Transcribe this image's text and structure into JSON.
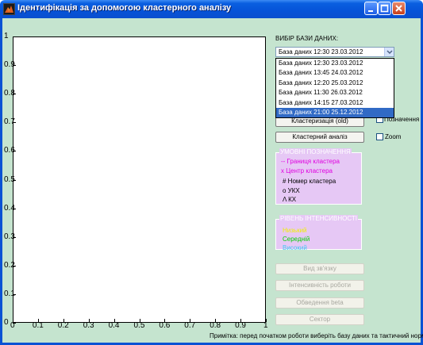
{
  "window": {
    "title": "Ідентифікація за допомогою кластерного аналізу"
  },
  "axes": {
    "y_ticks": [
      "1",
      "0.9",
      "0.8",
      "0.7",
      "0.6",
      "0.5",
      "0.4",
      "0.3",
      "0.2",
      "0.1",
      "0"
    ],
    "x_ticks": [
      "0",
      "0.1",
      "0.2",
      "0.3",
      "0.4",
      "0.5",
      "0.6",
      "0.7",
      "0.8",
      "0.9",
      "1"
    ]
  },
  "database": {
    "label": "ВИБІР БАЗИ ДАНИХ:",
    "selected": "База даних 12:30 23.03.2012",
    "options": [
      "База даних 12:30 23.03.2012",
      "База даних 13:45 24.03.2012",
      "База даних 12:20 25.03.2012",
      "База даних 11:30 26.03.2012",
      "База даних 14:15 27.03.2012",
      "База даних 21:00 25.12.2012"
    ],
    "highlighted_index": 5
  },
  "buttons": {
    "clusterize_old": "Кластеризація (old)",
    "cluster_analysis": "Кластерний аналіз",
    "link_type": "Вид зв'язку",
    "work_intensity": "Інтенсивність роботи",
    "volume_beta": "Обведення beta",
    "sector": "Сектор"
  },
  "checkboxes": {
    "partial_label": "а",
    "designations": "Позначення",
    "zoom": "Zoom"
  },
  "legend_group": {
    "title": "УМОВНІ ПОЗНАЧЕННЯ",
    "items": [
      {
        "text": "-- Границя кластера",
        "color": "#e000e0"
      },
      {
        "text": "x Центр кластера",
        "color": "#e000e0"
      },
      {
        "text": "# Номер кластера",
        "color": "#000000"
      },
      {
        "text": "o УКХ",
        "color": "#000000"
      },
      {
        "text": "Λ КХ",
        "color": "#000000"
      }
    ]
  },
  "intensity_group": {
    "title": "РІВЕНЬ ІНТЕНСИВНОСТІ",
    "items": [
      {
        "text": "Низький",
        "color": "#f0f000"
      },
      {
        "text": "Середній",
        "color": "#00d000"
      },
      {
        "text": "Високий",
        "color": "#40c8f0"
      }
    ]
  },
  "footer_note": "Примітка: перед початком роботи виберіть базу даних та тактичний норматив",
  "colors": {
    "background": "#c5e4cf",
    "groupbox": "#e6c8f5",
    "selection": "#316ac5",
    "titlebar": "#0653d8"
  }
}
